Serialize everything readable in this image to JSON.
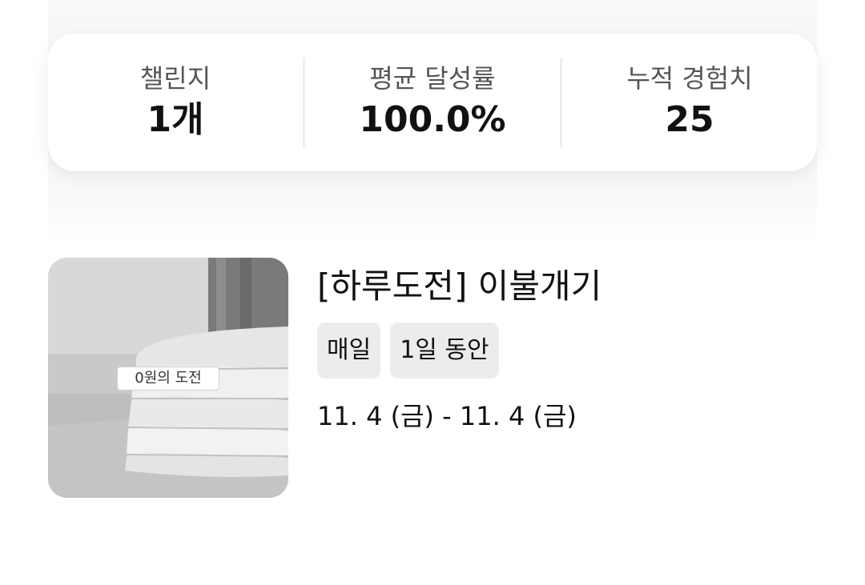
{
  "stats": {
    "challenges": {
      "label": "챌린지",
      "value": "1개"
    },
    "avg_rate": {
      "label": "평균 달성률",
      "value": "100.0%"
    },
    "total_xp": {
      "label": "누적 경험치",
      "value": "25"
    }
  },
  "challenge": {
    "title": "[하루도전] 이불개기",
    "thumbnail_badge": "0원의 도전",
    "tags": [
      "매일",
      "1일 동안"
    ],
    "date_range": "11. 4 (금) - 11. 4 (금)"
  }
}
